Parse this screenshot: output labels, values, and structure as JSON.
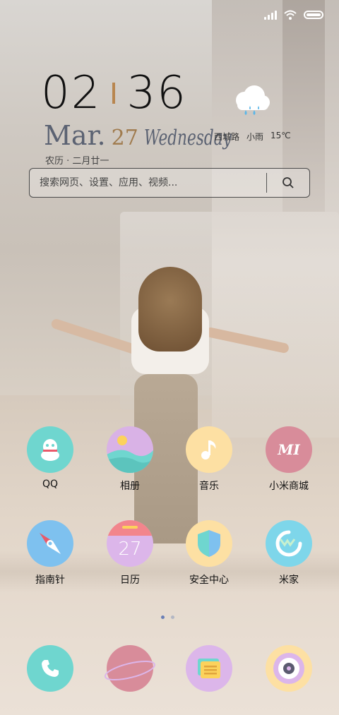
{
  "status": {
    "icons": [
      "signal-icon",
      "wifi-icon",
      "battery-icon"
    ]
  },
  "clock": {
    "hours": "02",
    "minutes": "36",
    "month": "Mar.",
    "day": "27",
    "weekday": "Wednesday",
    "lunar": "农历 · 二月廿一"
  },
  "weather": {
    "icon": "rain-cloud-icon",
    "location": "西城路",
    "condition": "小雨",
    "temperature": "15℃"
  },
  "search": {
    "placeholder": "搜索网页、设置、应用、视频..."
  },
  "apps": [
    {
      "label": "QQ",
      "icon": "qq-icon",
      "color": "#6fd6cf"
    },
    {
      "label": "相册",
      "icon": "gallery-icon",
      "color": "#d9b2e6"
    },
    {
      "label": "音乐",
      "icon": "music-icon",
      "color": "#fde0a3"
    },
    {
      "label": "小米商城",
      "icon": "mi-store-icon",
      "color": "#d88c9a"
    },
    {
      "label": "指南针",
      "icon": "compass-icon",
      "color": "#7ec1ef"
    },
    {
      "label": "日历",
      "icon": "calendar-icon",
      "color": "#dcb6ea",
      "number": "27"
    },
    {
      "label": "安全中心",
      "icon": "shield-icon",
      "color": "#fde0a3"
    },
    {
      "label": "米家",
      "icon": "mijia-icon",
      "color": "#7ed6ea"
    }
  ],
  "pager": {
    "pages": 2,
    "current": 1
  },
  "dock": [
    {
      "icon": "phone-icon",
      "color": "#6fd6cf"
    },
    {
      "icon": "browser-planet-icon",
      "color": "#d88c9a"
    },
    {
      "icon": "messages-icon",
      "color": "#dcb6ea"
    },
    {
      "icon": "camera-icon",
      "color": "#fde0a3"
    }
  ]
}
